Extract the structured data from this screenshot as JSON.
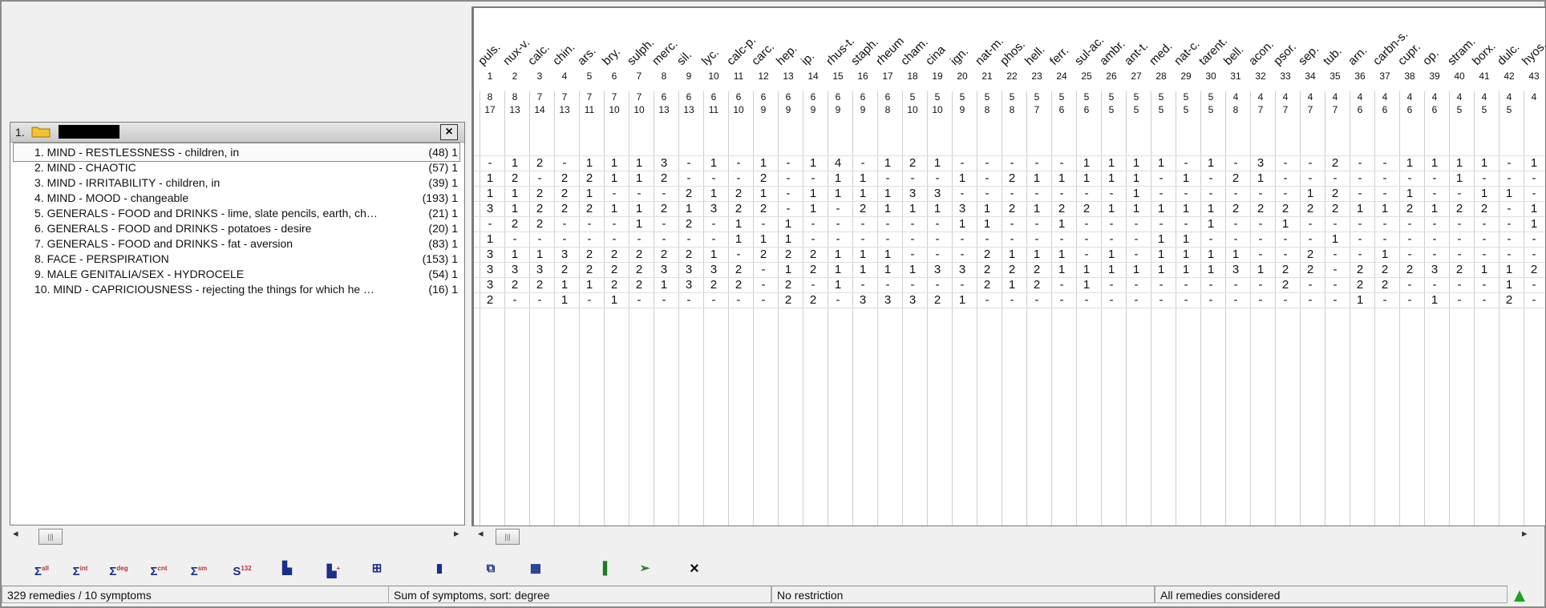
{
  "left_panel": {
    "section_number": "1.",
    "rubrics": [
      {
        "text": "1. MIND - RESTLESSNESS - children, in",
        "count": "(48) 1"
      },
      {
        "text": "2. MIND - CHAOTIC",
        "count": "(57) 1"
      },
      {
        "text": "3. MIND - IRRITABILITY - children, in",
        "count": "(39) 1"
      },
      {
        "text": "4. MIND - MOOD - changeable",
        "count": "(193) 1"
      },
      {
        "text": "5. GENERALS - FOOD and DRINKS - lime, slate pencils, earth, chalk...",
        "count": "(21) 1"
      },
      {
        "text": "6. GENERALS - FOOD and DRINKS - potatoes - desire",
        "count": "(20) 1"
      },
      {
        "text": "7. GENERALS - FOOD and DRINKS - fat - aversion",
        "count": "(83) 1"
      },
      {
        "text": "8. FACE - PERSPIRATION",
        "count": "(153) 1"
      },
      {
        "text": "9. MALE GENITALIA/SEX - HYDROCELE",
        "count": "(54) 1"
      },
      {
        "text": "10. MIND - CAPRICIOUSNESS - rejecting the things for which he has...",
        "count": "(16) 1"
      }
    ]
  },
  "grid": {
    "remedies": [
      "puls.",
      "nux-v.",
      "calc.",
      "chin.",
      "ars.",
      "bry.",
      "sulph.",
      "merc.",
      "sil.",
      "lyc.",
      "calc-p.",
      "carc.",
      "hep.",
      "ip.",
      "rhus-t.",
      "staph.",
      "rheum",
      "cham.",
      "cina",
      "ign.",
      "nat-m.",
      "phos.",
      "hell.",
      "ferr.",
      "sul-ac.",
      "ambr.",
      "ant-t.",
      "med.",
      "nat-c.",
      "tarent.",
      "bell.",
      "acon.",
      "psor.",
      "sep.",
      "tub.",
      "arn.",
      "carbn-s.",
      "cupr.",
      "op.",
      "stram.",
      "borx.",
      "dulc.",
      "hyos."
    ],
    "numbers": [
      "1",
      "2",
      "3",
      "4",
      "5",
      "6",
      "7",
      "8",
      "9",
      "10",
      "11",
      "12",
      "13",
      "14",
      "15",
      "16",
      "17",
      "18",
      "19",
      "20",
      "21",
      "22",
      "23",
      "24",
      "25",
      "26",
      "27",
      "28",
      "29",
      "30",
      "31",
      "32",
      "33",
      "34",
      "35",
      "36",
      "37",
      "38",
      "39",
      "40",
      "41",
      "42",
      "43"
    ],
    "score_a": [
      "8",
      "8",
      "7",
      "7",
      "7",
      "7",
      "7",
      "6",
      "6",
      "6",
      "6",
      "6",
      "6",
      "6",
      "6",
      "6",
      "6",
      "5",
      "5",
      "5",
      "5",
      "5",
      "5",
      "5",
      "5",
      "5",
      "5",
      "5",
      "5",
      "5",
      "4",
      "4",
      "4",
      "4",
      "4",
      "4",
      "4",
      "4",
      "4",
      "4",
      "4",
      "4",
      "4"
    ],
    "score_b": [
      "17",
      "13",
      "14",
      "13",
      "11",
      "10",
      "10",
      "13",
      "13",
      "11",
      "10",
      "9",
      "9",
      "9",
      "9",
      "9",
      "8",
      "10",
      "10",
      "9",
      "8",
      "8",
      "7",
      "6",
      "6",
      "5",
      "5",
      "5",
      "5",
      "5",
      "8",
      "7",
      "7",
      "7",
      "7",
      "6",
      "6",
      "6",
      "6",
      "5",
      "5",
      "5",
      ""
    ],
    "rows": [
      [
        "-",
        "1",
        "2",
        "-",
        "1",
        "1",
        "1",
        "3",
        "-",
        "1",
        "-",
        "1",
        "-",
        "1",
        "4",
        "-",
        "1",
        "2",
        "1",
        "-",
        "-",
        "-",
        "-",
        "-",
        "1",
        "1",
        "1",
        "1",
        "-",
        "1",
        "-",
        "3",
        "-",
        "-",
        "2",
        "-",
        "-",
        "1",
        "1",
        "1",
        "1",
        "-",
        "1"
      ],
      [
        "1",
        "2",
        "-",
        "2",
        "2",
        "1",
        "1",
        "2",
        "-",
        "-",
        "-",
        "2",
        "-",
        "-",
        "1",
        "1",
        "-",
        "-",
        "-",
        "1",
        "-",
        "2",
        "1",
        "1",
        "1",
        "1",
        "1",
        "-",
        "1",
        "-",
        "2",
        "1",
        "-",
        "-",
        "-",
        "-",
        "-",
        "-",
        "-",
        "1",
        "-",
        "-",
        "-"
      ],
      [
        "1",
        "1",
        "2",
        "2",
        "1",
        "-",
        "-",
        "-",
        "2",
        "1",
        "2",
        "1",
        "-",
        "1",
        "1",
        "1",
        "1",
        "3",
        "3",
        "-",
        "-",
        "-",
        "-",
        "-",
        "-",
        "-",
        "1",
        "-",
        "-",
        "-",
        "-",
        "-",
        "-",
        "1",
        "2",
        "-",
        "-",
        "1",
        "-",
        "-",
        "1",
        "1",
        "-"
      ],
      [
        "3",
        "1",
        "2",
        "2",
        "2",
        "1",
        "1",
        "2",
        "1",
        "3",
        "2",
        "2",
        "-",
        "1",
        "-",
        "2",
        "1",
        "1",
        "1",
        "3",
        "1",
        "2",
        "1",
        "2",
        "2",
        "1",
        "1",
        "1",
        "1",
        "1",
        "2",
        "2",
        "2",
        "2",
        "2",
        "1",
        "1",
        "2",
        "1",
        "2",
        "2",
        "-",
        "1"
      ],
      [
        "-",
        "2",
        "2",
        "-",
        "-",
        "-",
        "1",
        "-",
        "2",
        "-",
        "1",
        "-",
        "1",
        "-",
        "-",
        "-",
        "-",
        "-",
        "-",
        "1",
        "1",
        "-",
        "-",
        "1",
        "-",
        "-",
        "-",
        "-",
        "-",
        "1",
        "-",
        "-",
        "1",
        "-",
        "-",
        "-",
        "-",
        "-",
        "-",
        "-",
        "-",
        "-",
        "1"
      ],
      [
        "1",
        "-",
        "-",
        "-",
        "-",
        "-",
        "-",
        "-",
        "-",
        "-",
        "1",
        "1",
        "1",
        "-",
        "-",
        "-",
        "-",
        "-",
        "-",
        "-",
        "-",
        "-",
        "-",
        "-",
        "-",
        "-",
        "-",
        "1",
        "1",
        "-",
        "-",
        "-",
        "-",
        "-",
        "1",
        "-",
        "-",
        "-",
        "-",
        "-",
        "-",
        "-",
        "-"
      ],
      [
        "3",
        "1",
        "1",
        "3",
        "2",
        "2",
        "2",
        "2",
        "2",
        "1",
        "-",
        "2",
        "2",
        "2",
        "1",
        "1",
        "1",
        "-",
        "-",
        "-",
        "2",
        "1",
        "1",
        "1",
        "-",
        "1",
        "-",
        "1",
        "1",
        "1",
        "1",
        "-",
        "-",
        "2",
        "-",
        "-",
        "1",
        "-",
        "-",
        "-",
        "-",
        "-",
        "-"
      ],
      [
        "3",
        "3",
        "3",
        "2",
        "2",
        "2",
        "2",
        "3",
        "3",
        "3",
        "2",
        "-",
        "1",
        "2",
        "1",
        "1",
        "1",
        "1",
        "3",
        "3",
        "2",
        "2",
        "2",
        "1",
        "1",
        "1",
        "1",
        "1",
        "1",
        "1",
        "3",
        "1",
        "2",
        "2",
        "-",
        "2",
        "2",
        "2",
        "3",
        "2",
        "1",
        "1",
        "2"
      ],
      [
        "3",
        "2",
        "2",
        "1",
        "1",
        "2",
        "2",
        "1",
        "3",
        "2",
        "2",
        "-",
        "2",
        "-",
        "1",
        "-",
        "-",
        "-",
        "-",
        "-",
        "2",
        "1",
        "2",
        "-",
        "1",
        "-",
        "-",
        "-",
        "-",
        "-",
        "-",
        "-",
        "2",
        "-",
        "-",
        "2",
        "2",
        "-",
        "-",
        "-",
        "-",
        "1",
        "-"
      ],
      [
        "2",
        "-",
        "-",
        "1",
        "-",
        "1",
        "-",
        "-",
        "-",
        "-",
        "-",
        "-",
        "2",
        "2",
        "-",
        "3",
        "3",
        "3",
        "2",
        "1",
        "-",
        "-",
        "-",
        "-",
        "-",
        "-",
        "-",
        "-",
        "-",
        "-",
        "-",
        "-",
        "-",
        "-",
        "-",
        "1",
        "-",
        "-",
        "1",
        "-",
        "-",
        "2",
        "-"
      ]
    ]
  },
  "toolbar": [
    {
      "name": "sum-all-button",
      "glyph": "Σ",
      "sub": "all"
    },
    {
      "name": "sum-intensity-button",
      "glyph": "Σ",
      "sub": "int"
    },
    {
      "name": "sum-degree-button",
      "glyph": "Σ",
      "sub": "deg"
    },
    {
      "name": "sum-count-button",
      "glyph": "Σ",
      "sub": "cnt"
    },
    {
      "name": "sum-small-button",
      "glyph": "Σ",
      "sub": "sm"
    },
    {
      "name": "sort-132-button",
      "glyph": "S",
      "sub": "132"
    },
    {
      "name": "chart-red-button",
      "glyph": "▙",
      "sub": ""
    },
    {
      "name": "chart-plus-button",
      "glyph": "▙",
      "sub": "+"
    },
    {
      "name": "table-view-button",
      "glyph": "⊞",
      "sub": ""
    },
    {
      "name": "bottle-button",
      "glyph": "▮",
      "sub": ""
    },
    {
      "name": "copy-grid-button",
      "glyph": "⧉",
      "sub": ""
    },
    {
      "name": "numbers-grid-button",
      "glyph": "▦",
      "sub": ""
    },
    {
      "name": "bar-chart-button",
      "glyph": "▐",
      "sub": ""
    },
    {
      "name": "export-button",
      "glyph": "➢",
      "sub": ""
    },
    {
      "name": "clear-button",
      "glyph": "×",
      "sub": ""
    }
  ],
  "status": {
    "remedies_symptoms": "329 remedies / 10 symptoms",
    "sort": "Sum of symptoms, sort: degree",
    "restriction": "No restriction",
    "considered": "All remedies considered"
  },
  "colors": {
    "accent": "#1a2f8a",
    "indicator": "#20a020"
  }
}
